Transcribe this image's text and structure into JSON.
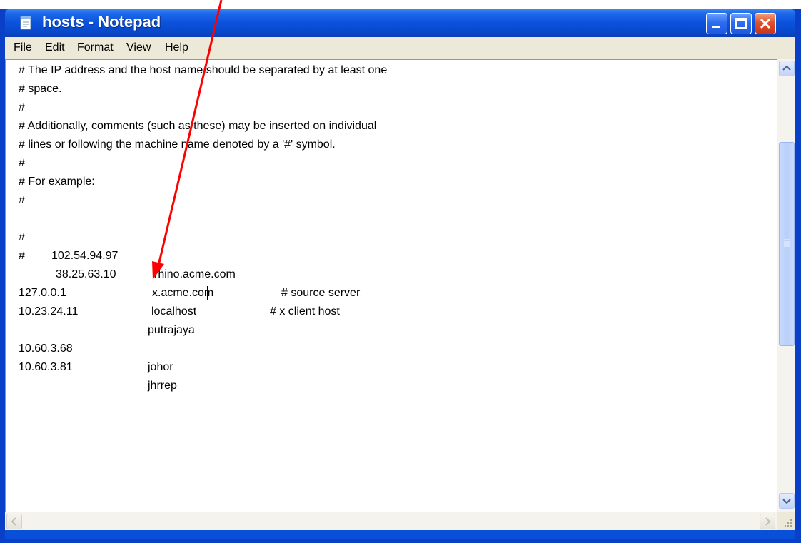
{
  "window": {
    "title": "hosts - Notepad"
  },
  "menu": [
    "File",
    "Edit",
    "Format",
    "View",
    "Help"
  ],
  "editor": {
    "lines": [
      "# The IP address and the host name should be separated by at least one",
      "# space.",
      "#",
      "# Additionally, comments (such as these) may be inserted on individual",
      "# lines or following the machine name denoted by a '#' symbol.",
      "#",
      "# For example:",
      "#"
    ],
    "examples": [
      {
        "hash": "#",
        "ip": "102.54.94.97",
        "host": "rhino.acme.com",
        "comment": "# source server"
      },
      {
        "hash": "#",
        "ip": "38.25.63.10",
        "host": "x.acme.com",
        "comment": "# x client host"
      }
    ],
    "entries": [
      {
        "ip": "127.0.0.1",
        "host": "localhost"
      },
      {
        "ip": "10.23.24.11",
        "host": "putrajaya"
      },
      {
        "ip": "10.60.3.68",
        "host": "johor"
      },
      {
        "ip": "10.60.3.81",
        "host": "jhrrep"
      }
    ]
  },
  "icons": {
    "app": "notepad-icon",
    "minimize": "minimize-icon",
    "maximize": "maximize-icon",
    "close": "close-icon",
    "scroll_up": "chevron-up-icon",
    "scroll_down": "chevron-down-icon",
    "scroll_left": "chevron-left-icon",
    "scroll_right": "chevron-right-icon",
    "annotation": "red-arrow-annotation"
  },
  "colors": {
    "titlebar": "#0a52dc",
    "close_button": "#e0502a",
    "annotation_arrow": "#ff0000"
  }
}
